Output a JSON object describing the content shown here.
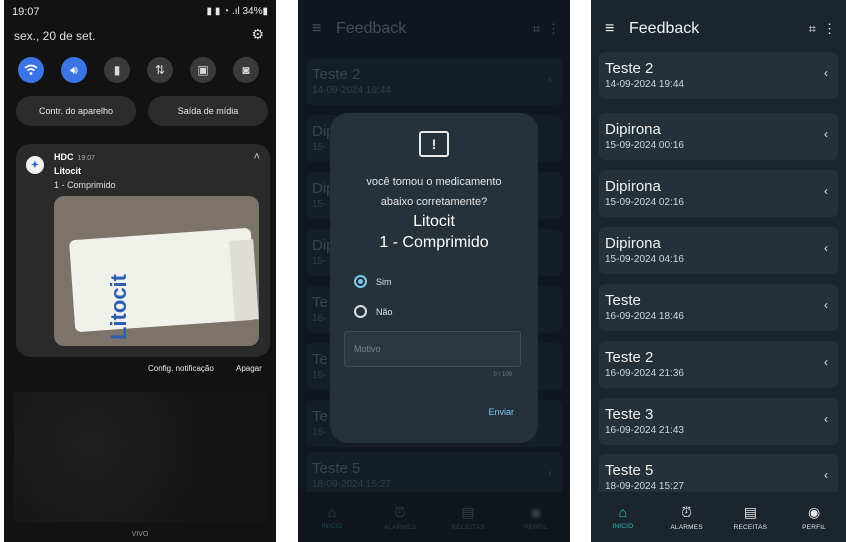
{
  "phone1": {
    "status_time": "19:07",
    "status_right": "▮ ▮ ◔ .ıl 34%▮",
    "date": "sex., 20 de set.",
    "device_control_label": "Contr. do aparelho",
    "media_output_label": "Saída de mídia",
    "notification": {
      "app": "HDC",
      "time": "19:07",
      "title": "Litocit",
      "text": "1 - Comprimido",
      "image_label": "Litocit"
    },
    "action_settings": "Config. notificação",
    "action_clear": "Apagar",
    "carrier": "VIVO"
  },
  "app": {
    "title": "Feedback",
    "nav": [
      {
        "label": "INICIO",
        "icon": "home-icon"
      },
      {
        "label": "ALARMES",
        "icon": "alarm-clock-icon"
      },
      {
        "label": "RECEITAS",
        "icon": "receipt-icon"
      },
      {
        "label": "PERFIL",
        "icon": "person-icon"
      }
    ],
    "items": [
      {
        "name": "Teste 2",
        "datetime": "14-09-2024 19:44"
      },
      {
        "name": "Dipirona",
        "datetime": "15-09-2024 00:16"
      },
      {
        "name": "Dipirona",
        "datetime": "15-09-2024 02:16"
      },
      {
        "name": "Dipirona",
        "datetime": "15-09-2024 04:16"
      },
      {
        "name": "Teste",
        "datetime": "16-09-2024 18:46"
      },
      {
        "name": "Teste 2",
        "datetime": "16-09-2024 21:36"
      },
      {
        "name": "Teste 3",
        "datetime": "16-09-2024 21:43"
      },
      {
        "name": "Teste 5",
        "datetime": "18-09-2024 15:27"
      }
    ],
    "partial_names": [
      "Dip",
      "Dip",
      "Dip",
      "Te",
      "Te",
      "Te"
    ],
    "partial_dates": [
      "15-",
      "15-",
      "15-",
      "16-",
      "16-",
      "16-"
    ]
  },
  "dialog": {
    "question_line1": "você tomou o medicamento",
    "question_line2": "abaixo corretamente?",
    "medication": "Litocit",
    "dose": "1 - Comprimido",
    "option_yes": "Sim",
    "option_no": "Não",
    "reason_placeholder": "Motivo",
    "counter": "0 / 100",
    "send_label": "Enviar"
  },
  "colors": {
    "accent": "#27c8c0",
    "dialog_link": "#7ec8f0",
    "quick_toggle_on": "#3b74e4"
  }
}
